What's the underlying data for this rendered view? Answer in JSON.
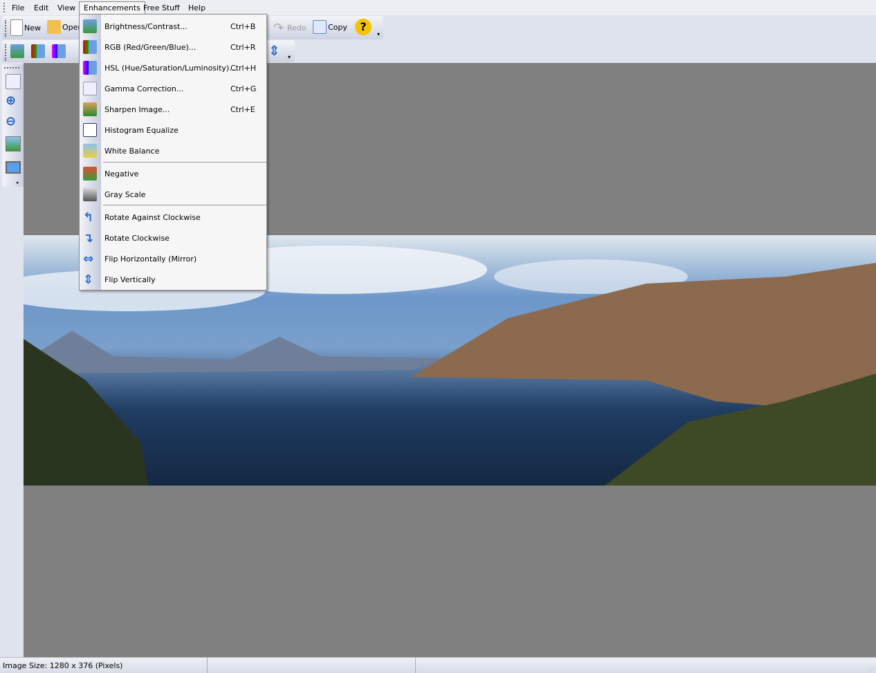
{
  "menubar": {
    "items": [
      "File",
      "Edit",
      "View",
      "Enhancements",
      "Free Stuff",
      "Help"
    ]
  },
  "toolbar1": {
    "new": "New",
    "open": "Open",
    "redo": "Redo",
    "copy": "Copy"
  },
  "enh_menu": {
    "items": [
      {
        "label": "Brightness/Contrast...",
        "shortcut": "Ctrl+B",
        "icon": "brightness-icon"
      },
      {
        "label": "RGB (Red/Green/Blue)...",
        "shortcut": "Ctrl+R",
        "icon": "rgb-icon"
      },
      {
        "label": "HSL (Hue/Saturation/Luminosity)...",
        "shortcut": "Ctrl+H",
        "icon": "hsl-icon"
      },
      {
        "label": "Gamma Correction...",
        "shortcut": "Ctrl+G",
        "icon": "gamma-icon"
      },
      {
        "label": "Sharpen Image...",
        "shortcut": "Ctrl+E",
        "icon": "sharpen-icon"
      },
      {
        "label": "Histogram Equalize",
        "shortcut": "",
        "icon": "histogram-icon"
      },
      {
        "label": "White Balance",
        "shortcut": "",
        "icon": "white-balance-icon"
      },
      {
        "label": "Negative",
        "shortcut": "",
        "icon": "negative-icon"
      },
      {
        "label": "Gray Scale",
        "shortcut": "",
        "icon": "grayscale-icon"
      },
      {
        "label": "Rotate Against Clockwise",
        "shortcut": "",
        "icon": "rotate-ccw-icon"
      },
      {
        "label": "Rotate Clockwise",
        "shortcut": "",
        "icon": "rotate-cw-icon"
      },
      {
        "label": "Flip Horizontally (Mirror)",
        "shortcut": "",
        "icon": "flip-horizontal-icon"
      },
      {
        "label": "Flip Vertically",
        "shortcut": "",
        "icon": "flip-vertical-icon"
      }
    ]
  },
  "status": {
    "image_size": "Image Size: 1280 x 376 (Pixels)"
  }
}
